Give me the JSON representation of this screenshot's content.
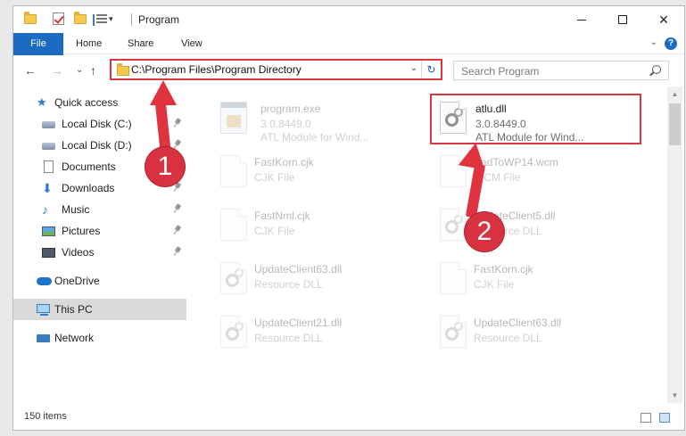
{
  "window": {
    "title": "Program",
    "minimize_glyph": "—",
    "close_glyph": "✕"
  },
  "ribbon": {
    "tabs": [
      "File",
      "Home",
      "Share",
      "View"
    ],
    "help": "?"
  },
  "navigation": {
    "back": "←",
    "forward": "→",
    "recent": "⌄",
    "up": "↑"
  },
  "address": {
    "path": "C:\\Program Files\\Program Directory",
    "dropdown": "⌄",
    "refresh": "↻"
  },
  "search": {
    "placeholder": "Search Program"
  },
  "nav_pane": {
    "quick_access": "Quick access",
    "items": [
      {
        "label": "Local Disk (C:)",
        "icon": "drive-icon",
        "pinned": true
      },
      {
        "label": "Local Disk (D:)",
        "icon": "drive-icon",
        "pinned": true
      },
      {
        "label": "Documents",
        "icon": "documents-icon",
        "pinned": true
      },
      {
        "label": "Downloads",
        "icon": "downloads-icon",
        "pinned": true
      },
      {
        "label": "Music",
        "icon": "music-icon",
        "pinned": true
      },
      {
        "label": "Pictures",
        "icon": "pictures-icon",
        "pinned": true
      },
      {
        "label": "Videos",
        "icon": "videos-icon",
        "pinned": true
      }
    ],
    "onedrive": "OneDrive",
    "this_pc": "This PC",
    "network": "Network"
  },
  "files": [
    {
      "name": "program.exe",
      "line2": "3.0.8449.0",
      "line3": "ATL Module for Wind...",
      "type": "exe",
      "highlighted": false
    },
    {
      "name": "atlu.dll",
      "line2": "3.0.8449.0",
      "line3": "ATL Module for Wind...",
      "type": "dll",
      "highlighted": true
    },
    {
      "name": "FastKorn.cjk",
      "line2": "CJK File",
      "type": "file"
    },
    {
      "name": "PadToWP14.wcm",
      "line2": "WCM File",
      "type": "file"
    },
    {
      "name": "FastNml.cjk",
      "line2": "CJK File",
      "type": "file"
    },
    {
      "name": "UpdateClient5.dll",
      "line2": "Resource DLL",
      "type": "dll"
    },
    {
      "name": "UpdateClient63.dll",
      "line2": "Resource DLL",
      "type": "dll"
    },
    {
      "name": "FastKorn.cjk",
      "line2": "CJK File",
      "type": "file"
    },
    {
      "name": "UpdateClient21.dll",
      "line2": "Resource DLL",
      "type": "dll"
    },
    {
      "name": "UpdateClient63.dll",
      "line2": "Resource DLL",
      "type": "dll"
    }
  ],
  "status": {
    "item_count": "150 items"
  },
  "annotations": {
    "step1": "1",
    "step2": "2",
    "color": "#e03340"
  },
  "colors": {
    "accent": "#1a6bc1",
    "highlight": "#d9363e",
    "selection": "#dadada"
  }
}
